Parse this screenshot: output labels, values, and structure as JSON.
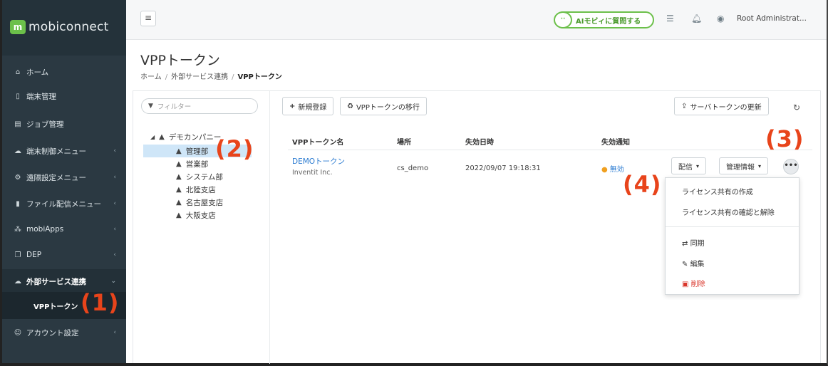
{
  "app": {
    "name": "mobiconnect"
  },
  "sidebar": {
    "items": [
      {
        "label": "ホーム",
        "icon": "home-icon"
      },
      {
        "label": "端末管理",
        "icon": "device-icon"
      },
      {
        "label": "ジョブ管理",
        "icon": "job-icon"
      },
      {
        "label": "端末制御メニュー",
        "icon": "remote-control-icon"
      },
      {
        "label": "遠隔設定メニュー",
        "icon": "cogs-icon"
      },
      {
        "label": "ファイル配信メニュー",
        "icon": "file-icon"
      },
      {
        "label": "mobiApps",
        "icon": "apps-icon"
      },
      {
        "label": "DEP",
        "icon": "dep-icon"
      },
      {
        "label": "外部サービス連携",
        "icon": "cloud-icon"
      },
      {
        "label": "アカウント設定",
        "icon": "users-icon"
      }
    ],
    "sub_item": "VPPトークン"
  },
  "topbar": {
    "ai_button": "AIモビィに質問する",
    "user_name": "Root Administrat..."
  },
  "page": {
    "title": "VPPトークン",
    "breadcrumb": [
      "ホーム",
      "外部サービス連携",
      "VPPトークン"
    ]
  },
  "filter": {
    "placeholder": "フィルター"
  },
  "tree": {
    "root": "デモカンパニー",
    "children": [
      "管理部",
      "営業部",
      "システム部",
      "北陸支店",
      "名古屋支店",
      "大阪支店"
    ],
    "selected": "管理部"
  },
  "toolbar": {
    "new_label": "新規登録",
    "migrate_label": "VPPトークンの移行",
    "update_label": "サーバトークンの更新"
  },
  "table": {
    "headers": [
      "VPPトークン名",
      "場所",
      "失効日時",
      "失効通知"
    ],
    "rows": [
      {
        "name": "DEMOトークン",
        "org": "Inventit Inc.",
        "location": "cs_demo",
        "expires": "2022/09/07 19:18:31",
        "notify": "無効",
        "deliver_label": "配信",
        "manage_label": "管理情報"
      }
    ]
  },
  "menu": {
    "items": [
      "ライセンス共有の作成",
      "ライセンス共有の確認と解除",
      "同期",
      "編集",
      "削除"
    ]
  },
  "annotations": [
    "(1)",
    "(2)",
    "(3)",
    "(4)"
  ],
  "colors": {
    "sidebar": "#2b3942",
    "accent": "#6cc04a",
    "link": "#2b7bd1",
    "annotation": "#e8441b",
    "danger": "#d9362b"
  }
}
